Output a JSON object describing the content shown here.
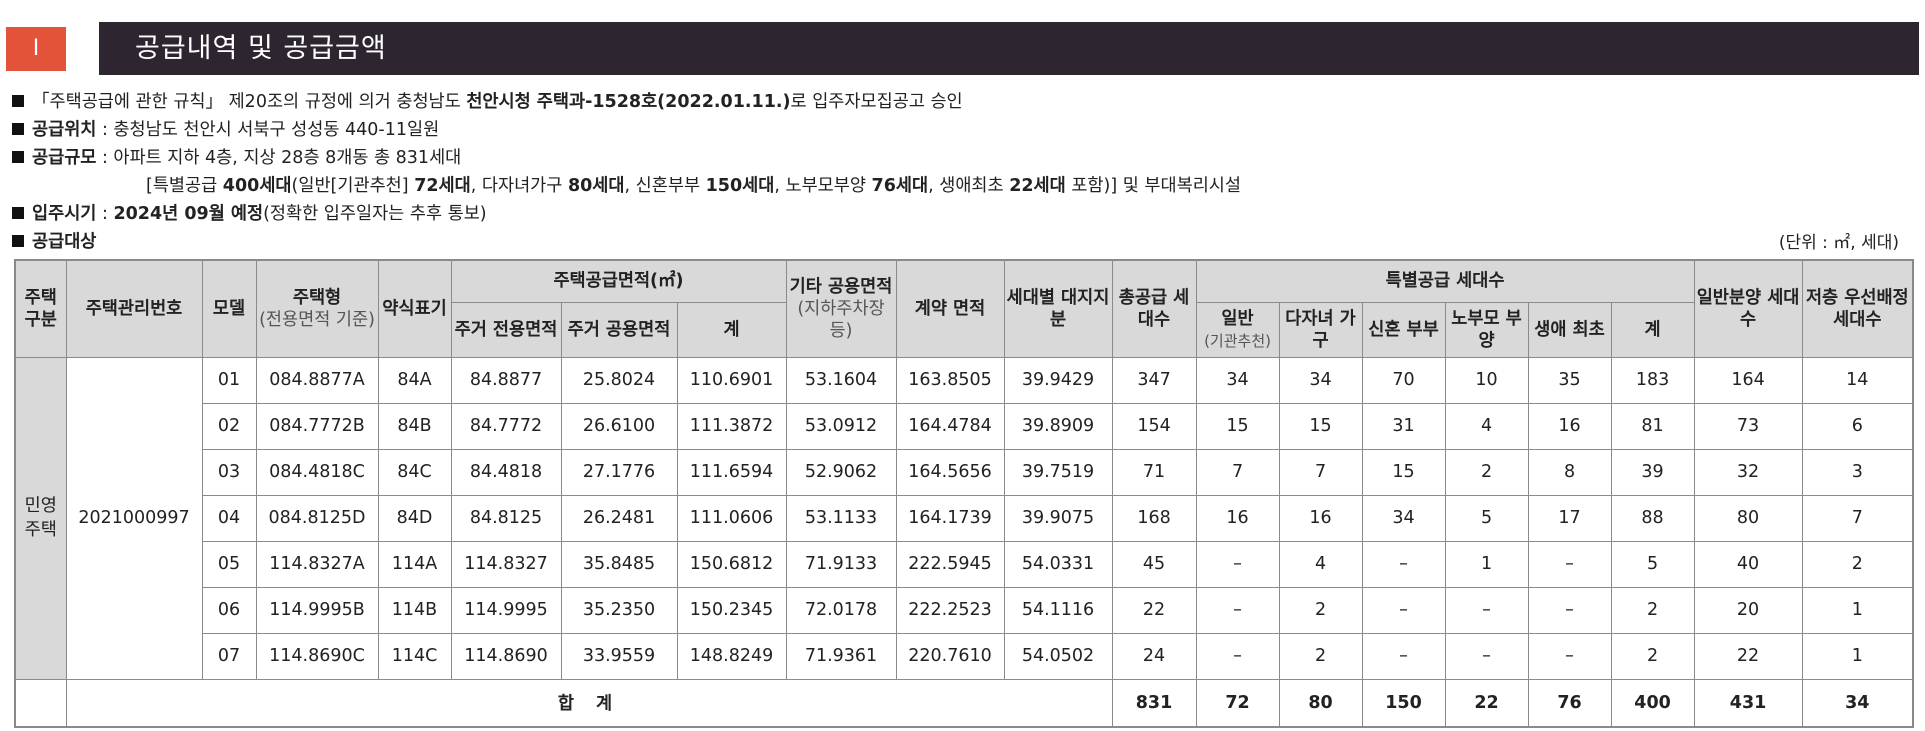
{
  "header": {
    "number": "I",
    "title": "공급내역 및 공급금액"
  },
  "info": {
    "l1_pre": "「주택공급에 관한 규칙」 제20조의 규정에 의거 충청남도 ",
    "l1_bold": "천안시청 주택과-1528호(2022.01.11.)",
    "l1_post": "로 입주자모집공고 승인",
    "l2_label": "공급위치",
    "l2_text": " : 충청남도 천안시 서북구 성성동 440-11일원",
    "l3_label": "공급규모",
    "l3_text": " : 아파트 지하 4층, 지상 28층 8개동 총 831세대",
    "l4_a": "[특별공급 ",
    "l4_b": "400세대",
    "l4_c": "(일반[기관추천] ",
    "l4_d": "72세대",
    "l4_e": ", 다자녀가구 ",
    "l4_f": "80세대",
    "l4_g": ", 신혼부부 ",
    "l4_h": "150세대",
    "l4_i": ", 노부모부양 ",
    "l4_j": "76세대",
    "l4_k": ", 생애최초 ",
    "l4_l": "22세대",
    "l4_m": " 포함)] 및 부대복리시설",
    "l5_label": "입주시기",
    "l5_text": " : ",
    "l5_bold": "2024년 09월 예정",
    "l5_post": "(정확한 입주일자는 추후 통보)",
    "l6_label": "공급대상"
  },
  "unit_note": "(단위 : ㎡, 세대)",
  "table": {
    "headers": {
      "housing_type": "주택구분",
      "mgmt_no": "주택관리번호",
      "model": "모델",
      "house_type": "주택형",
      "house_type_sub": "(전용면적 기준)",
      "abbr": "약식표기",
      "supply_area": "주택공급면적(㎡)",
      "residential_exclusive": "주거 전용면적",
      "residential_common": "주거 공용면적",
      "sum": "계",
      "other_common": "기타 공용면적",
      "other_common_sub": "(지하주차장 등)",
      "contract_area": "계약 면적",
      "land_share": "세대별 대지지분",
      "total_units": "총공급 세대수",
      "special_units": "특별공급 세대수",
      "general_inst": "일반",
      "general_inst_sub": "(기관추천)",
      "multi_child": "다자녀 가구",
      "newlywed": "신혼 부부",
      "elderly": "노부모 부양",
      "first_time": "생애 최초",
      "special_sum": "계",
      "general_sale": "일반분양 세대수",
      "low_floor": "저층 우선배정 세대수"
    },
    "housing_type_value": "민영 주택",
    "mgmt_no_value": "2021000997",
    "rows": [
      [
        "01",
        "084.8877A",
        "84A",
        "84.8877",
        "25.8024",
        "110.6901",
        "53.1604",
        "163.8505",
        "39.9429",
        "347",
        "34",
        "34",
        "70",
        "10",
        "35",
        "183",
        "164",
        "14"
      ],
      [
        "02",
        "084.7772B",
        "84B",
        "84.7772",
        "26.6100",
        "111.3872",
        "53.0912",
        "164.4784",
        "39.8909",
        "154",
        "15",
        "15",
        "31",
        "4",
        "16",
        "81",
        "73",
        "6"
      ],
      [
        "03",
        "084.4818C",
        "84C",
        "84.4818",
        "27.1776",
        "111.6594",
        "52.9062",
        "164.5656",
        "39.7519",
        "71",
        "7",
        "7",
        "15",
        "2",
        "8",
        "39",
        "32",
        "3"
      ],
      [
        "04",
        "084.8125D",
        "84D",
        "84.8125",
        "26.2481",
        "111.0606",
        "53.1133",
        "164.1739",
        "39.9075",
        "168",
        "16",
        "16",
        "34",
        "5",
        "17",
        "88",
        "80",
        "7"
      ],
      [
        "05",
        "114.8327A",
        "114A",
        "114.8327",
        "35.8485",
        "150.6812",
        "71.9133",
        "222.5945",
        "54.0331",
        "45",
        "–",
        "4",
        "–",
        "1",
        "–",
        "5",
        "40",
        "2"
      ],
      [
        "06",
        "114.9995B",
        "114B",
        "114.9995",
        "35.2350",
        "150.2345",
        "72.0178",
        "222.2523",
        "54.1116",
        "22",
        "–",
        "2",
        "–",
        "–",
        "–",
        "2",
        "20",
        "1"
      ],
      [
        "07",
        "114.8690C",
        "114C",
        "114.8690",
        "33.9559",
        "148.8249",
        "71.9361",
        "220.7610",
        "54.0502",
        "24",
        "–",
        "2",
        "–",
        "–",
        "–",
        "2",
        "22",
        "1"
      ]
    ],
    "total": {
      "label": "합 계",
      "values": [
        "831",
        "72",
        "80",
        "150",
        "22",
        "76",
        "400",
        "431",
        "34"
      ]
    }
  }
}
